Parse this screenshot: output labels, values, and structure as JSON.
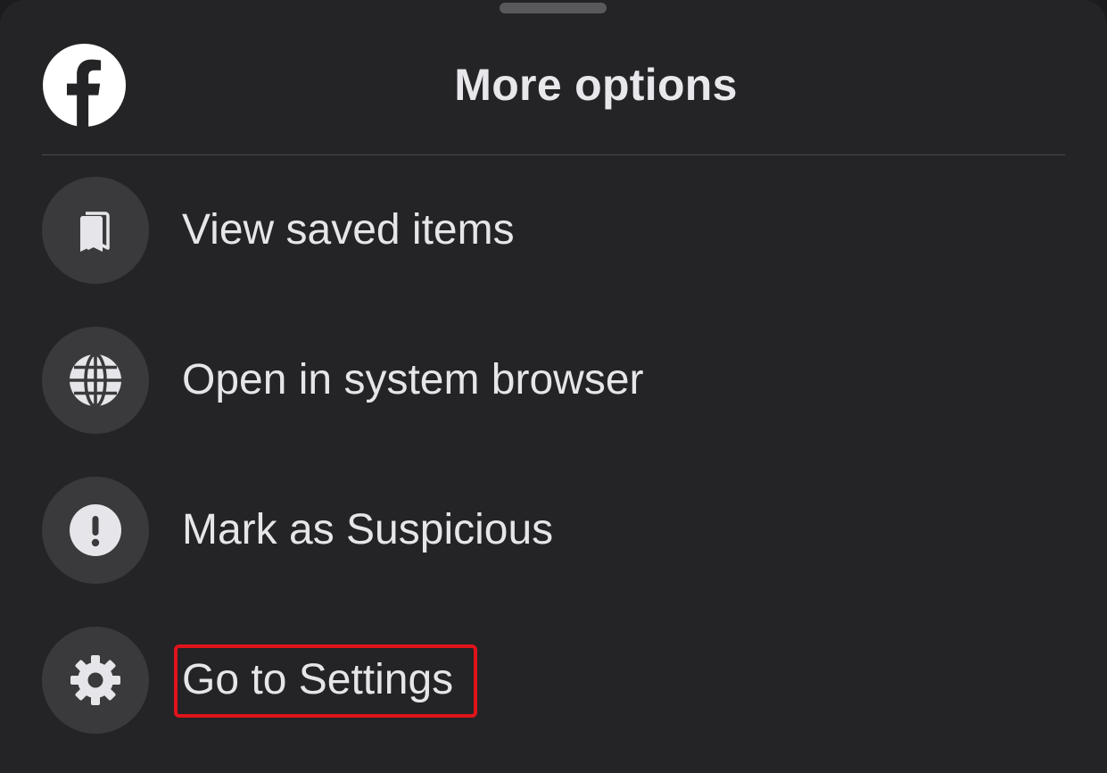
{
  "sheet": {
    "title": "More options",
    "logo_icon": "facebook-logo",
    "handle_icon": "drag-handle"
  },
  "menu": {
    "items": [
      {
        "label": "View saved items",
        "icon": "bookmark-icon"
      },
      {
        "label": "Open in system browser",
        "icon": "globe-icon"
      },
      {
        "label": "Mark as Suspicious",
        "icon": "exclamation-icon"
      },
      {
        "label": "Go to Settings",
        "icon": "gear-icon"
      }
    ]
  },
  "highlight": {
    "target": "Go to Settings",
    "color": "#e0131b"
  },
  "colors": {
    "background": "#242426",
    "icon_circle": "#3a3a3c",
    "text": "#e6e6ea",
    "divider": "#4a4a4e"
  }
}
